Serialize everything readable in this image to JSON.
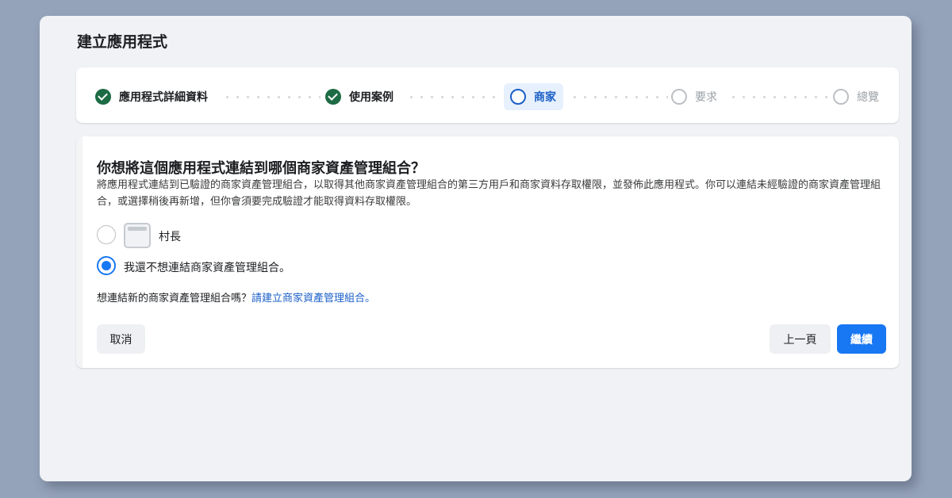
{
  "page": {
    "title": "建立應用程式"
  },
  "stepper": {
    "steps": [
      {
        "label": "應用程式詳細資料",
        "state": "done"
      },
      {
        "label": "使用案例",
        "state": "done"
      },
      {
        "label": "商家",
        "state": "active"
      },
      {
        "label": "要求",
        "state": "todo"
      },
      {
        "label": "總覽",
        "state": "todo"
      }
    ]
  },
  "card": {
    "title": "你想將這個應用程式連結到哪個商家資產管理組合？",
    "description": "將應用程式連結到已驗證的商家資產管理組合，以取得其他商家資產管理組合的第三方用戶和商家資料存取權限，並發佈此應用程式。你可以連結未經驗證的商家資產管理組合，或選擇稍後再新增，但你會須要完成驗證才能取得資料存取權限。",
    "options": [
      {
        "label": "村長",
        "icon": "briefcase-icon",
        "selected": false
      },
      {
        "label": "我還不想連結商家資產管理組合。",
        "selected": true
      }
    ],
    "link_prompt": "想連結新的商家資產管理組合嗎？",
    "link_text": "請建立商家資產管理組合。"
  },
  "actions": {
    "cancel_label": "取消",
    "back_label": "上一頁",
    "continue_label": "繼續"
  },
  "colors": {
    "background": "#95a3ba",
    "accent": "#1877f2",
    "done": "#1c6b44",
    "active_step_bg": "#e7f0fd"
  }
}
